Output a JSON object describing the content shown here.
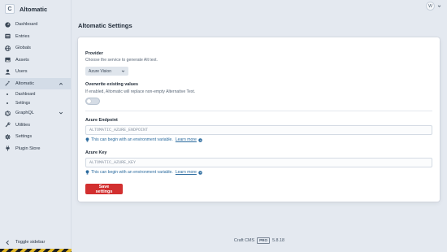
{
  "brand": {
    "badge": "C",
    "name": "Altomatic"
  },
  "sidebar": {
    "items": [
      {
        "label": "Dashboard",
        "icon": "gauge-icon"
      },
      {
        "label": "Entries",
        "icon": "entries-icon"
      },
      {
        "label": "Globals",
        "icon": "globe-icon"
      },
      {
        "label": "Assets",
        "icon": "image-icon"
      },
      {
        "label": "Users",
        "icon": "user-icon"
      },
      {
        "label": "Altomatic",
        "icon": "magic-icon",
        "active": true
      },
      {
        "label": "GraphQL",
        "icon": "graphql-icon"
      },
      {
        "label": "Utilities",
        "icon": "wrench-icon"
      },
      {
        "label": "Settings",
        "icon": "gear-icon"
      },
      {
        "label": "Plugin Store",
        "icon": "plug-icon"
      }
    ],
    "subitems": [
      {
        "label": "Dashboard"
      },
      {
        "label": "Settings"
      }
    ],
    "toggle_label": "Toggle sidebar"
  },
  "user": {
    "initial": "W"
  },
  "page": {
    "title": "Altomatic Settings"
  },
  "form": {
    "provider": {
      "label": "Provider",
      "instructions": "Choose the service to generate Alt text.",
      "value": "Azure Vision"
    },
    "overwrite": {
      "label": "Overwrite existing values",
      "instructions": "If enabled, Altomatic will replace non-empty Alternative Text.",
      "enabled": false
    },
    "endpoint": {
      "label": "Azure Endpoint",
      "value": "ALTOMATIC_AZURE_ENDPOINT",
      "tip": "This can begin with an environment variable.",
      "link": "Learn more"
    },
    "key": {
      "label": "Azure Key",
      "value": "ALTOMATIC_AZURE_KEY",
      "tip": "This can begin with an environment variable.",
      "link": "Learn more"
    },
    "save_label": "Save settings"
  },
  "footer": {
    "product": "Craft CMS",
    "edition": "PRO",
    "version": "5.8.18"
  },
  "colors": {
    "accent": "#d22f2f",
    "background": "#e4e9f0",
    "tip": "#2a6a9e"
  }
}
